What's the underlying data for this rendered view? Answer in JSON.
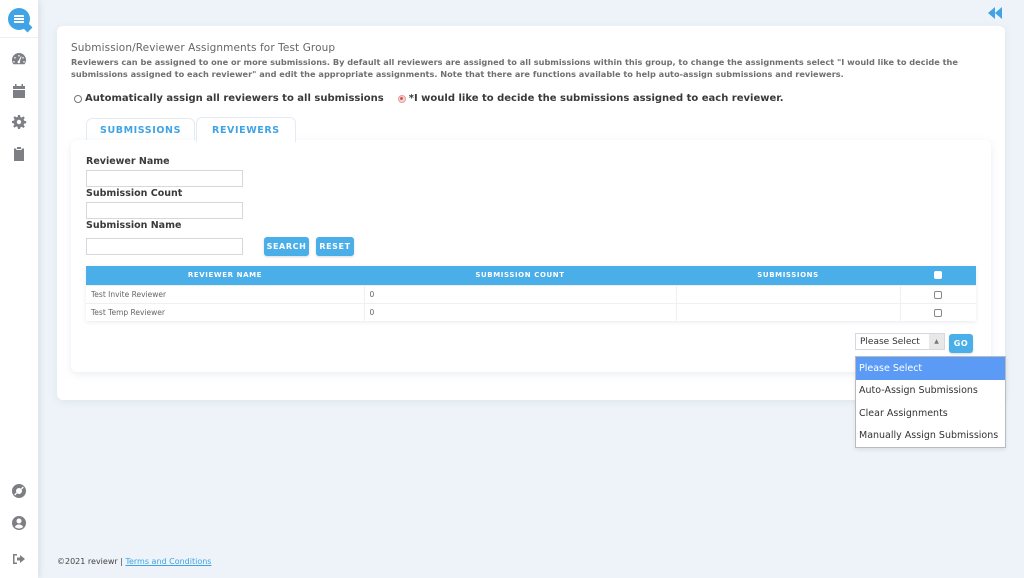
{
  "sidebar": {
    "logo": "reviewr-logo-icon",
    "top_items": [
      {
        "name": "dashboard",
        "icon": "speedometer-icon"
      },
      {
        "name": "calendar",
        "icon": "calendar-icon"
      },
      {
        "name": "settings",
        "icon": "gear-icon"
      },
      {
        "name": "clipboard",
        "icon": "clipboard-icon"
      }
    ],
    "bottom_items": [
      {
        "name": "help",
        "icon": "lifebuoy-icon"
      },
      {
        "name": "account",
        "icon": "user-circle-icon"
      },
      {
        "name": "logout",
        "icon": "sign-out-icon"
      }
    ]
  },
  "header": {
    "collapse_icon": "double-chevron-left-icon"
  },
  "page": {
    "title": "Submission/Reviewer Assignments for Test Group",
    "description": "Reviewers can be assigned to one or more submissions. By default all reviewers are assigned to all submissions within this group, to change the assignments select \"I would like to decide the submissions assigned to each reviewer\" and edit the appropriate assignments. Note that there are functions available to help auto-assign submissions and reviewers.",
    "assignment_mode": {
      "options": [
        {
          "label": "Automatically assign all reviewers to all submissions",
          "checked": false
        },
        {
          "label": "*I would like to decide the submissions assigned to each reviewer.",
          "checked": true
        }
      ]
    }
  },
  "tabs": [
    {
      "label": "SUBMISSIONS",
      "active": false
    },
    {
      "label": "REVIEWERS",
      "active": true
    }
  ],
  "filters": {
    "reviewer_name": {
      "label": "Reviewer Name",
      "value": ""
    },
    "submission_count": {
      "label": "Submission Count",
      "value": ""
    },
    "submission_name": {
      "label": "Submission Name",
      "value": ""
    },
    "search_label": "SEARCH",
    "reset_label": "RESET"
  },
  "table": {
    "columns": [
      "REVIEWER NAME",
      "SUBMISSION COUNT",
      "SUBMISSIONS"
    ],
    "rows": [
      {
        "reviewer_name": "Test Invite Reviewer",
        "submission_count": "0",
        "submissions": "",
        "checked": false
      },
      {
        "reviewer_name": "Test Temp Reviewer",
        "submission_count": "0",
        "submissions": "",
        "checked": false
      }
    ]
  },
  "bulk_action": {
    "selected": "Please Select",
    "go_label": "GO",
    "options": [
      "Please Select",
      "Auto-Assign Submissions",
      "Clear Assignments",
      "Manually Assign Submissions"
    ]
  },
  "footer": {
    "copyright": "©2021 reviewr |",
    "terms_link": "Terms and Conditions"
  },
  "colors": {
    "accent": "#4aaee8",
    "dropdown_highlight": "#5b9bf5",
    "background": "#edf3f8"
  }
}
